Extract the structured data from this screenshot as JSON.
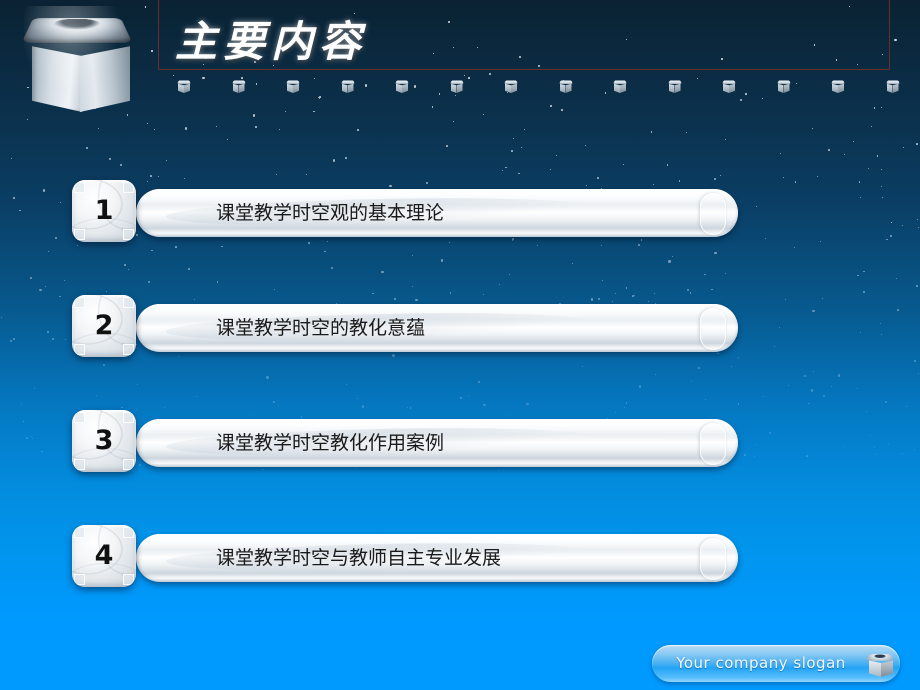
{
  "slide": {
    "title": "主要内容",
    "logo_icon": "cube-3d-icon",
    "accent_border_color": "#6b2d2a",
    "bg_top_color": "#0a2233",
    "bg_bottom_color": "#0099ff",
    "decor_cube_count": 14
  },
  "items": [
    {
      "number": "1",
      "label": "课堂教学时空观的基本理论"
    },
    {
      "number": "2",
      "label": "课堂教学时空的教化意蕴"
    },
    {
      "number": "3",
      "label": "课堂教学时空教化作用案例"
    },
    {
      "number": "4",
      "label": "课堂教学时空与教师自主专业发展"
    }
  ],
  "footer": {
    "slogan": "Your company  slogan",
    "icon": "cube-3d-icon",
    "pill_color": "#4eb2f2"
  }
}
